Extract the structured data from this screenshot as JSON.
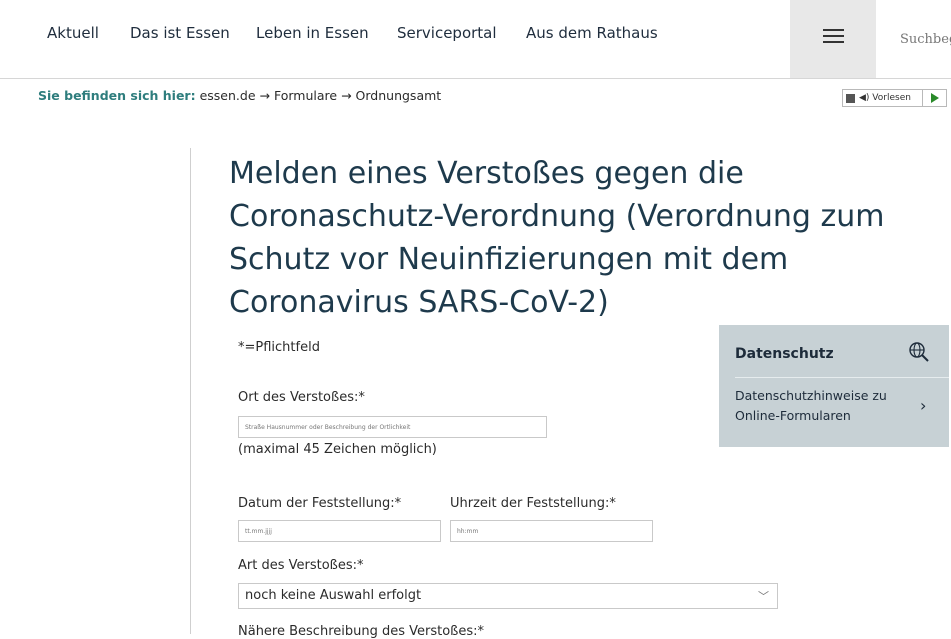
{
  "nav": {
    "items": [
      "Aktuell",
      "Das ist Essen",
      "Leben in Essen",
      "Serviceportal",
      "Aus dem Rathaus"
    ],
    "search_placeholder": "Suchbeg"
  },
  "breadcrumb": {
    "label": "Sie befinden sich hier:",
    "items": [
      "essen.de",
      "Formulare",
      "Ordnungsamt"
    ],
    "separator": "→"
  },
  "vorlesen": {
    "label": "Vorlesen"
  },
  "page_title": "Melden eines Verstoßes gegen die Coronaschutz-Verordnung (Verordnung zum Schutz vor Neuinfizierungen mit dem Coronavirus SARS-CoV-2)",
  "form": {
    "required_note": "*=Pflichtfeld",
    "location": {
      "label": "Ort des Verstoßes:*",
      "placeholder": "Straße Hausnummer oder Beschreibung der Örtlichkeit",
      "hint": "(maximal 45 Zeichen möglich)"
    },
    "date": {
      "label": "Datum der Feststellung:*",
      "placeholder": "tt.mm.jjjj"
    },
    "time": {
      "label": "Uhrzeit der Feststellung:*",
      "placeholder": "hh:mm"
    },
    "type": {
      "label": "Art des Verstoßes:*",
      "selected": "noch keine Auswahl erfolgt"
    },
    "description": {
      "label": "Nähere Beschreibung des Verstoßes:*"
    }
  },
  "datenschutz": {
    "title": "Datenschutz",
    "link": "Datenschutzhinweise zu Online-Formularen"
  },
  "colors": {
    "accent": "#2e7d7d",
    "title": "#1e3a4c",
    "sidebox": "#c7d1d5"
  }
}
